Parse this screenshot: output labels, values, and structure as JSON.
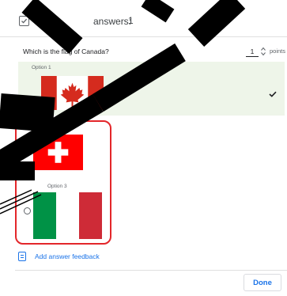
{
  "header": {
    "title": "answers:",
    "points_display": "1",
    "drag_handle": "∷"
  },
  "question": {
    "text": "Which is the flag of Canada?",
    "points_value": "1",
    "points_label": "points"
  },
  "options": [
    {
      "label": "Option 1",
      "flag": "canada-flag",
      "correct": true
    },
    {
      "label": "Option 2",
      "flag": "switzerland-flag",
      "correct": false
    },
    {
      "label": "Option 3",
      "flag": "italy-flag",
      "correct": false
    }
  ],
  "feedback": {
    "label": "Add answer feedback"
  },
  "footer": {
    "done_label": "Done"
  },
  "colors": {
    "accent": "#1a73e8",
    "correct_bg": "#eef5e9",
    "highlight": "#e3262a",
    "overlay": "#000000",
    "flag_red": "#d52b1e",
    "italy_green": "#009246",
    "italy_red": "#ce2b37"
  }
}
